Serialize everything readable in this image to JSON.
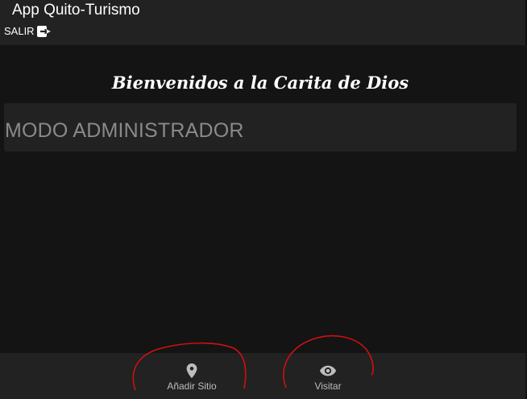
{
  "header": {
    "title": "App Quito-Turismo",
    "logout_label": "SALIR",
    "logout_icon": "logout-icon"
  },
  "main": {
    "welcome": "Bienvenidos a la Carita de Dios",
    "mode_label": "MODO ADMINISTRADOR"
  },
  "bottom_nav": {
    "items": [
      {
        "label": "Añadir Sitio",
        "icon": "location-pin-icon"
      },
      {
        "label": "Visitar",
        "icon": "eye-icon"
      }
    ]
  },
  "colors": {
    "background": "#141414",
    "bar": "#222222",
    "text": "#ffffff",
    "muted_text": "#8a8a8a",
    "annotation": "#d01010"
  }
}
